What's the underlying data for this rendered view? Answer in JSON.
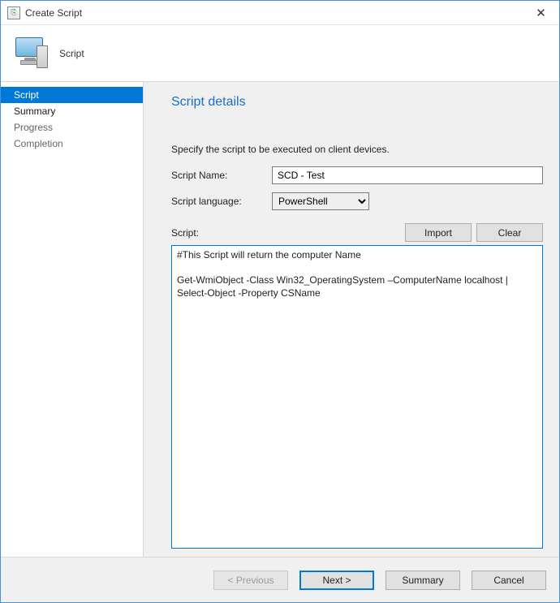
{
  "window": {
    "title": "Create Script",
    "close_glyph": "✕"
  },
  "header": {
    "label": "Script"
  },
  "sidebar": {
    "items": [
      {
        "label": "Script",
        "active": true
      },
      {
        "label": "Summary",
        "active": false
      },
      {
        "label": "Progress",
        "active": false
      },
      {
        "label": "Completion",
        "active": false
      }
    ]
  },
  "main": {
    "heading": "Script details",
    "instruction": "Specify the script to be executed on client devices.",
    "fields": {
      "script_name_label": "Script Name:",
      "script_name_value": "SCD - Test",
      "script_language_label": "Script language:",
      "script_language_value": "PowerShell",
      "script_language_options": [
        "PowerShell"
      ],
      "script_label": "Script:",
      "import_button": "Import",
      "clear_button": "Clear",
      "script_body": "#This Script will return the computer Name\n\nGet-WmiObject -Class Win32_OperatingSystem –ComputerName localhost | Select-Object -Property CSName"
    }
  },
  "footer": {
    "previous": "< Previous",
    "next": "Next >",
    "summary": "Summary",
    "cancel": "Cancel"
  },
  "colors": {
    "accent": "#0078d7",
    "heading": "#1a6fc4"
  }
}
